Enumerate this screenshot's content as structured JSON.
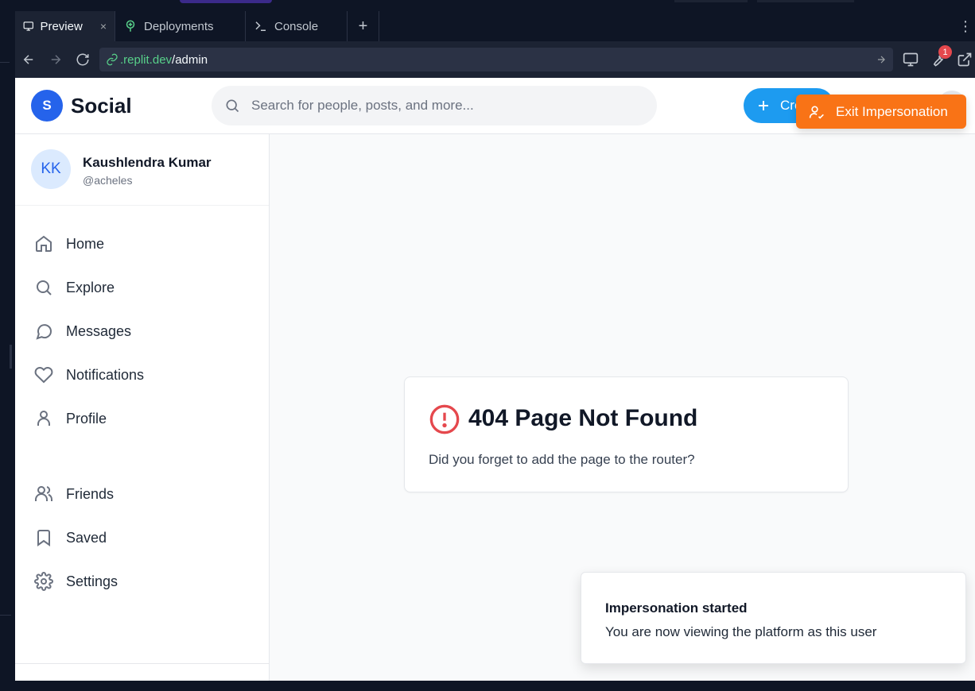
{
  "browser": {
    "tabs": [
      {
        "label": "Preview",
        "close": "×"
      },
      {
        "label": "Deployments"
      },
      {
        "label": "Console"
      }
    ],
    "add_tab": "+",
    "more": "⋮",
    "url": {
      "host": ".replit.dev",
      "path": "/admin"
    },
    "notification_count": "1"
  },
  "header": {
    "logo_letter": "S",
    "brand": "Social",
    "search_placeholder": "Search for people, posts, and more...",
    "create_label": "Create",
    "exit_impersonation_label": "Exit Impersonation"
  },
  "user": {
    "initials": "KK",
    "name": "Kaushlendra Kumar",
    "handle": "@acheles"
  },
  "sidebar": {
    "items": [
      {
        "label": "Home",
        "icon": "home-icon"
      },
      {
        "label": "Explore",
        "icon": "search-icon"
      },
      {
        "label": "Messages",
        "icon": "message-icon"
      },
      {
        "label": "Notifications",
        "icon": "heart-icon"
      },
      {
        "label": "Profile",
        "icon": "user-icon"
      },
      {
        "label": "Friends",
        "icon": "users-icon"
      },
      {
        "label": "Saved",
        "icon": "bookmark-icon"
      },
      {
        "label": "Settings",
        "icon": "gear-icon"
      }
    ]
  },
  "error_card": {
    "title": "404 Page Not Found",
    "message": "Did you forget to add the page to the router?"
  },
  "toast": {
    "title": "Impersonation started",
    "description": "You are now viewing the platform as this user"
  },
  "colors": {
    "accent": "#2563eb",
    "create": "#1d9bf0",
    "exit": "#f97316",
    "error": "#e5484d"
  }
}
